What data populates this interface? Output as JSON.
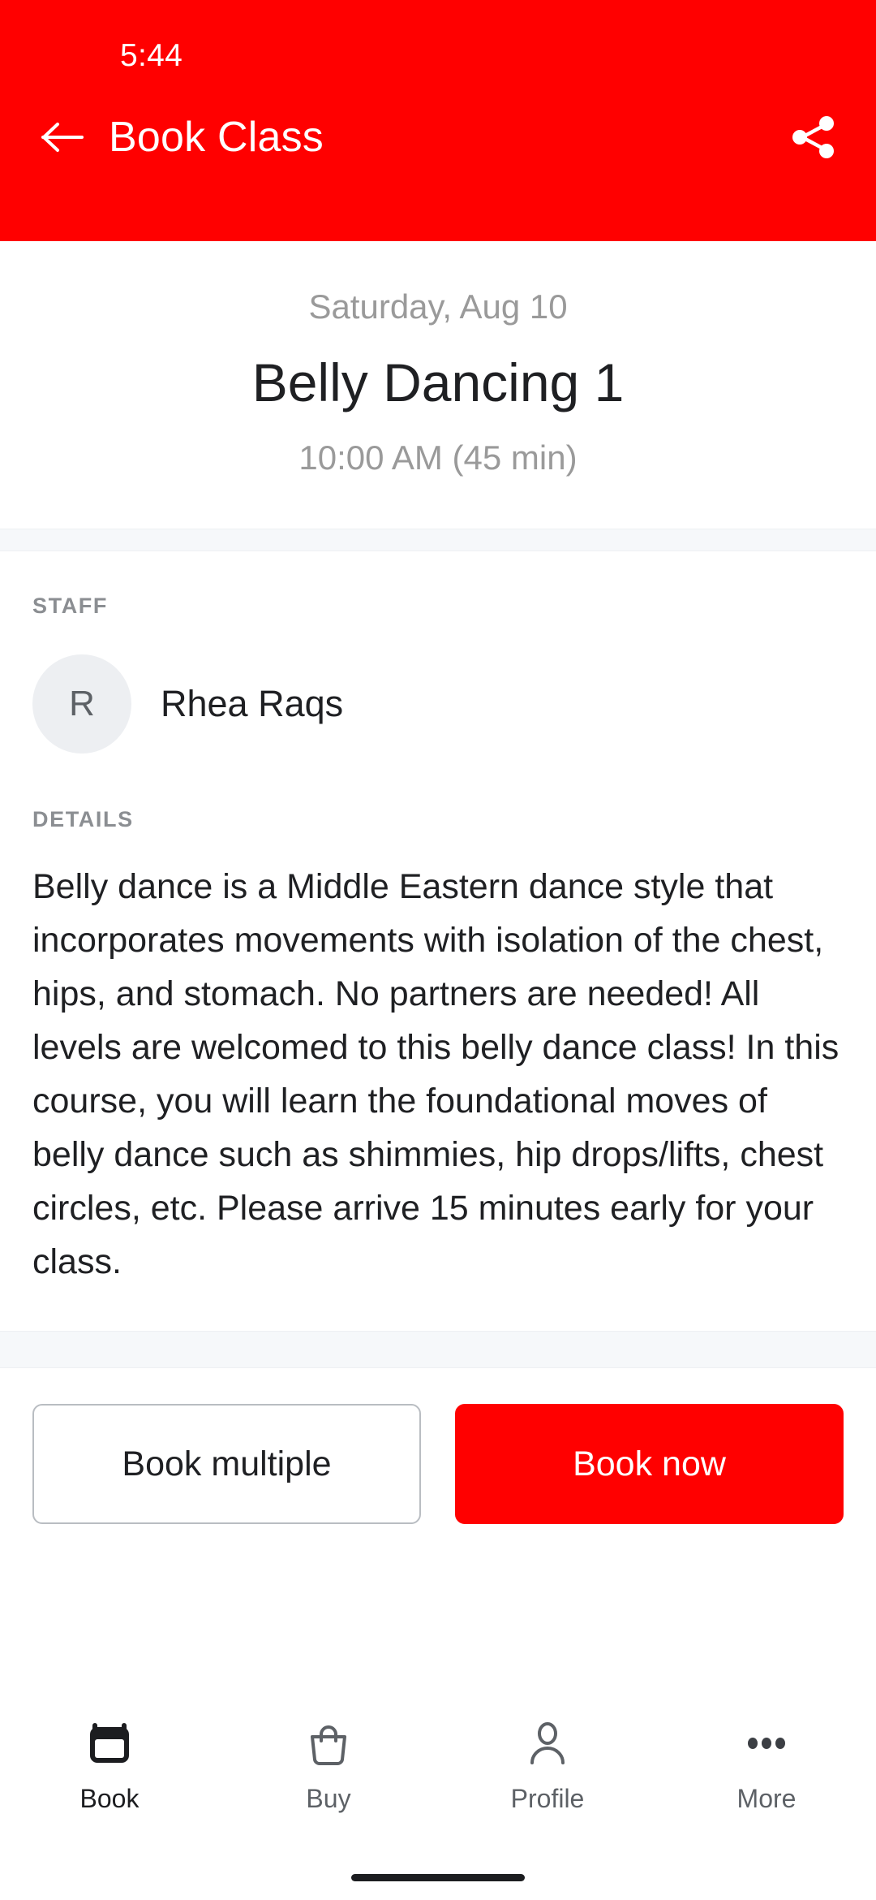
{
  "status_bar": {
    "time": "5:44"
  },
  "app_bar": {
    "title": "Book Class",
    "back_icon": "arrow-left-icon",
    "share_icon": "share-icon",
    "background_color": "#FF0000",
    "text_color": "#FFFFFF"
  },
  "class": {
    "date": "Saturday, Aug 10",
    "name": "Belly Dancing 1",
    "time": "10:00 AM (45 min)"
  },
  "staff": {
    "label": "STAFF",
    "avatar_initial": "R",
    "name": "Rhea Raqs"
  },
  "details": {
    "label": "DETAILS",
    "text": "Belly dance is a Middle Eastern dance style that incorporates movements with isolation of the chest, hips, and stomach. No partners are needed! All levels are welcomed to this belly dance class! In this course, you will learn the foundational moves of belly dance such as shimmies, hip drops/lifts, chest circles, etc. Please arrive 15 minutes early for your class."
  },
  "actions": {
    "book_multiple_label": "Book multiple",
    "book_now_label": "Book now",
    "primary_color": "#FF0000"
  },
  "bottom_nav": {
    "items": [
      {
        "label": "Book",
        "icon": "calendar-icon",
        "active": true
      },
      {
        "label": "Buy",
        "icon": "shopping-bag-icon",
        "active": false
      },
      {
        "label": "Profile",
        "icon": "person-icon",
        "active": false
      },
      {
        "label": "More",
        "icon": "ellipsis-icon",
        "active": false
      }
    ]
  }
}
